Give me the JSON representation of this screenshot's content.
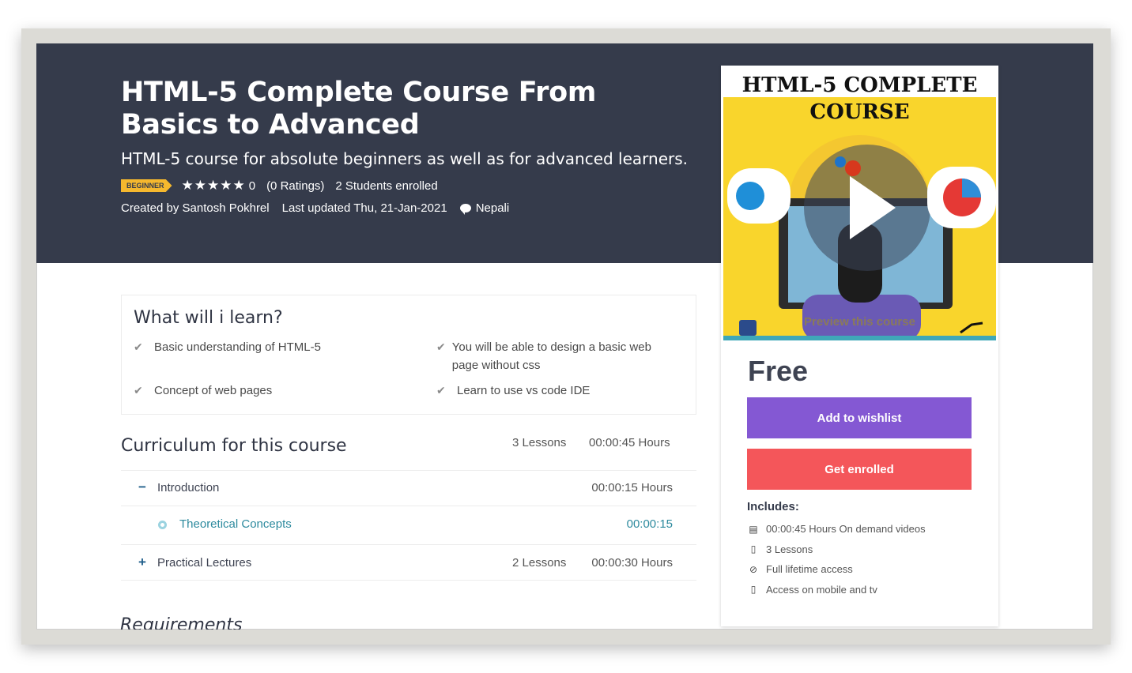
{
  "hero": {
    "title": "HTML-5 Complete Course From Basics to Advanced",
    "subtitle": "HTML-5 course for absolute beginners as well as for advanced learners.",
    "level_badge": "BEGINNER",
    "stars": "★★★★★",
    "rating_value": "0",
    "ratings_count": "(0 Ratings)",
    "students": "2 Students enrolled",
    "created_by": "Created by Santosh Pokhrel",
    "last_updated": "Last updated Thu, 21-Jan-2021",
    "language": "Nepali"
  },
  "card": {
    "thumb_title_line1": "HTML-5 COMPLETE",
    "thumb_title_line2": "COURSE",
    "preview_label": "Preview this course",
    "price": "Free",
    "wishlist_label": "Add to wishlist",
    "enroll_label": "Get enrolled",
    "includes_title": "Includes:",
    "includes": [
      {
        "icon": "video-file-icon",
        "text": "00:00:45 Hours On demand videos"
      },
      {
        "icon": "file-icon",
        "text": "3 Lessons"
      },
      {
        "icon": "lifetime-icon",
        "text": "Full lifetime access"
      },
      {
        "icon": "mobile-icon",
        "text": "Access on mobile and tv"
      }
    ]
  },
  "learn": {
    "title": "What will i learn?",
    "items": [
      "Basic understanding of HTML-5",
      "You will be able to design a basic web page without css",
      "Concept of web pages",
      "Learn to use vs code IDE"
    ]
  },
  "curriculum": {
    "title": "Curriculum for this course",
    "lessons": "3 Lessons",
    "hours": "00:00:45 Hours",
    "sections": [
      {
        "sign": "−",
        "label": "Introduction",
        "lessons": "",
        "hours": "00:00:15 Hours"
      },
      {
        "sign": "+",
        "label": "Practical Lectures",
        "lessons": "2 Lessons",
        "hours": "00:00:30 Hours"
      }
    ],
    "lecture": {
      "label": "Theoretical Concepts",
      "duration": "00:00:15"
    }
  },
  "requirements": {
    "title": "Requirements"
  },
  "colors": {
    "hero_bg": "#353b4b",
    "badge": "#f5b82e",
    "wishlist": "#8458d3",
    "enroll": "#f4565a",
    "lecture_link": "#2d8a9e"
  }
}
